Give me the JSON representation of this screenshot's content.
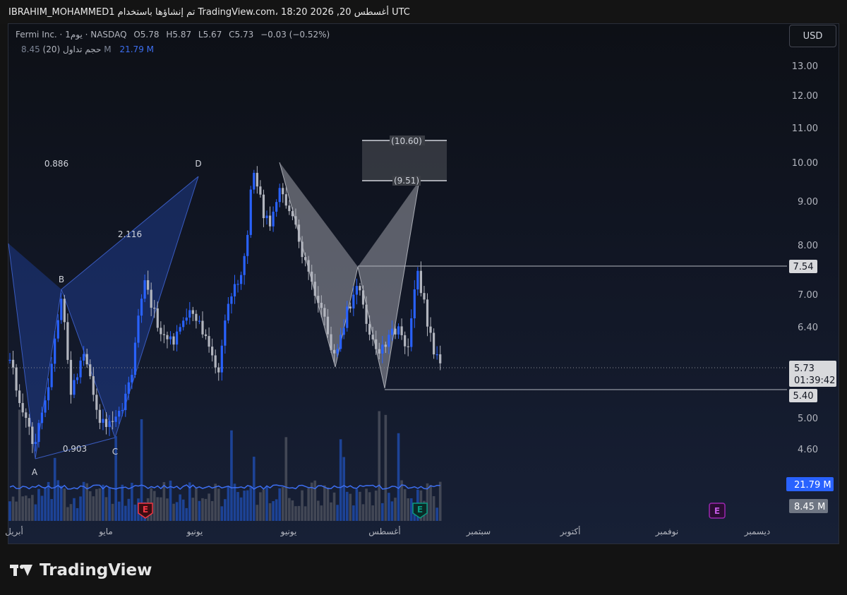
{
  "header": {
    "text": "IBRAHIM_MOHAMMED1 تم إنشاؤها باستخدام TradingView.com، 18:20 2026 ,20 أغسطس UTC"
  },
  "legend": {
    "symbol": "Fermi Inc. · 1يوم · NASDAQ",
    "open": "O5.78",
    "high": "H5.87",
    "low": "L5.67",
    "close": "C5.73",
    "change": "−0.03 (−0.52%)",
    "volume_label": "حجم تداول (20)",
    "volume_value": "8.45 M",
    "volume_ma": "21.79 M"
  },
  "toolbar": {
    "currency": "USD"
  },
  "price_axis": {
    "ticks": [
      "13.00",
      "12.00",
      "11.00",
      "10.00",
      "9.00",
      "8.00",
      "7.00",
      "6.40",
      "5.00",
      "4.60"
    ],
    "current_price": "5.73",
    "countdown": "01:39:42",
    "level_upper": "7.54",
    "level_lower": "5.40",
    "volume_ma_label": "21.79 M",
    "volume_label": "8.45 M"
  },
  "time_axis": {
    "labels": [
      "أبريل",
      "مايو",
      "يونيو",
      "يوليو",
      "أغسطس",
      "سبتمبر",
      "أكتوبر",
      "نوفمبر",
      "ديسمبر"
    ]
  },
  "pattern_blue": {
    "points": [
      "A",
      "B",
      "C",
      "D"
    ],
    "ratios": [
      "0.886",
      "2.116",
      "0.903"
    ]
  },
  "pattern_gray": {
    "target_top": "(10.60)",
    "target_bottom": "(9.51)"
  },
  "earnings_markers": [
    "E",
    "E",
    "E"
  ],
  "colors": {
    "up": "#2962ff",
    "down": "#b2b5be",
    "pattern_blue": "#1e3a8a",
    "pattern_gray": "#8a8d94",
    "earnings_red": "#f23645",
    "earnings_teal": "#089981",
    "earnings_purple": "#9c27b0"
  },
  "brand": {
    "name": "TradingView"
  }
}
